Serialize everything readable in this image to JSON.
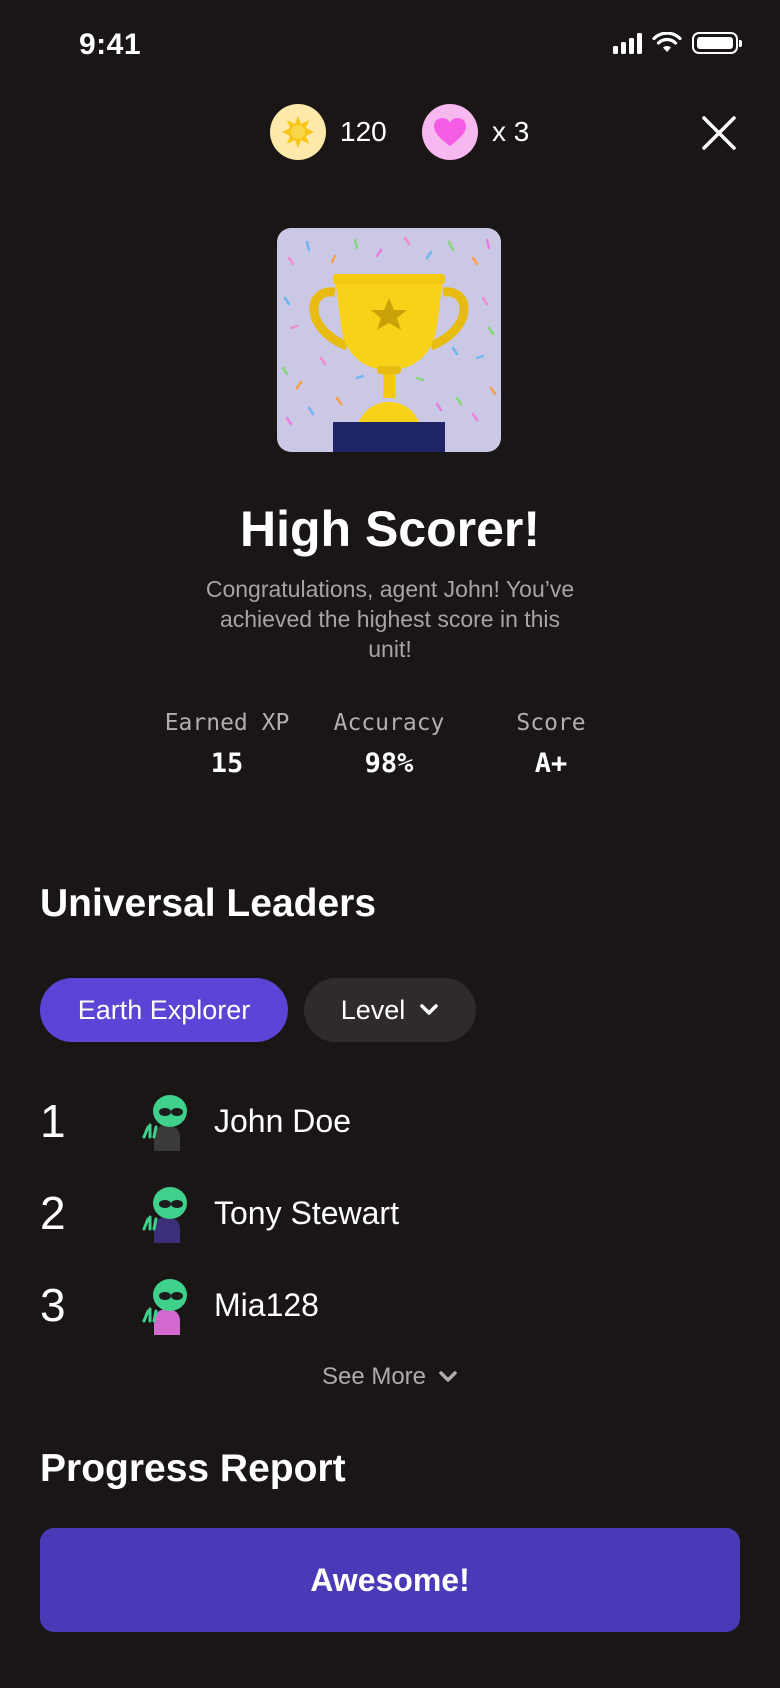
{
  "status": {
    "time": "9:41"
  },
  "header": {
    "coins": "120",
    "lives": "x 3",
    "coin_icon": "sun-coin-icon",
    "heart_icon": "heart-icon",
    "close_icon": "close-icon"
  },
  "achievement": {
    "title": "High Scorer!",
    "subtitle": "Congratulations, agent John! You’ve achieved the highest score in this unit!",
    "image": "trophy-icon"
  },
  "stats": [
    {
      "label": "Earned XP",
      "value": "15"
    },
    {
      "label": "Accuracy",
      "value": "98%"
    },
    {
      "label": "Score",
      "value": "A+"
    }
  ],
  "leaders": {
    "title": "Universal Leaders",
    "filters": {
      "active": "Earth Explorer",
      "dropdown": "Level"
    },
    "rows": [
      {
        "rank": "1",
        "name": "John Doe",
        "shirt": "#3a3a3a"
      },
      {
        "rank": "2",
        "name": "Tony Stewart",
        "shirt": "#3b2f7a"
      },
      {
        "rank": "3",
        "name": "Mia128",
        "shirt": "#d46ad0"
      }
    ],
    "see_more": "See More"
  },
  "progress": {
    "title": "Progress Report"
  },
  "cta": {
    "label": "Awesome!"
  },
  "colors": {
    "background": "#1a1616",
    "accent": "#5b44d6",
    "cta": "#4a3ab8",
    "trophy": "#f7d218",
    "alien": "#3fd18b"
  }
}
